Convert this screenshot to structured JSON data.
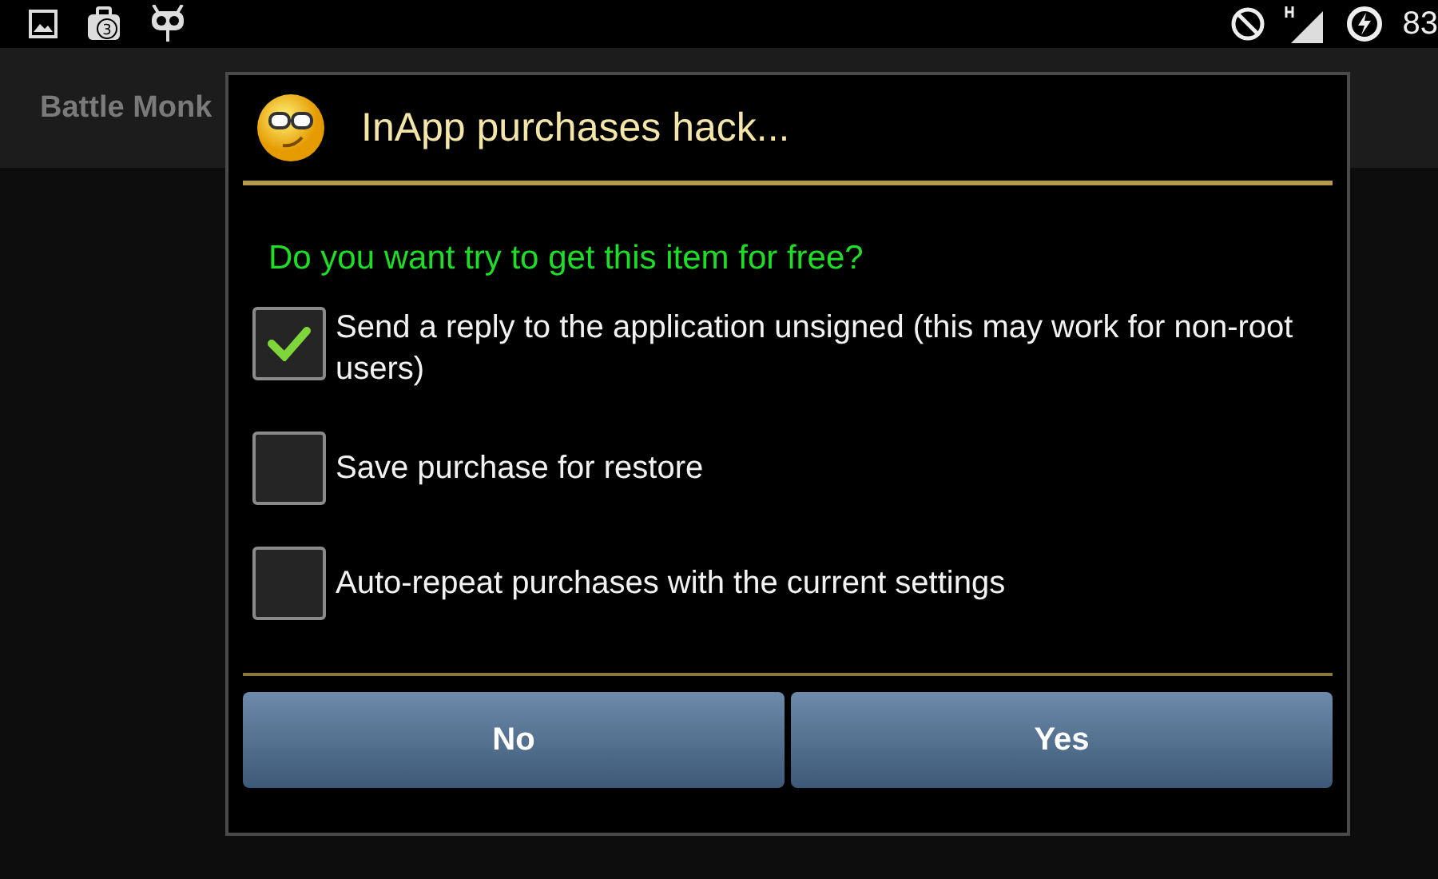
{
  "status_bar": {
    "notification_badge": "3",
    "battery": "83"
  },
  "app_bar": {
    "title": "Battle Monk"
  },
  "dialog": {
    "title": "InApp purchases hack...",
    "question": "Do you want try to get this item for free?",
    "options": [
      {
        "label": "Send a reply to the application unsigned (this may work for non-root users)",
        "checked": true
      },
      {
        "label": "Save purchase for restore",
        "checked": false
      },
      {
        "label": "Auto-repeat purchases with the current settings",
        "checked": false
      }
    ],
    "buttons": [
      "No",
      "Yes"
    ]
  }
}
